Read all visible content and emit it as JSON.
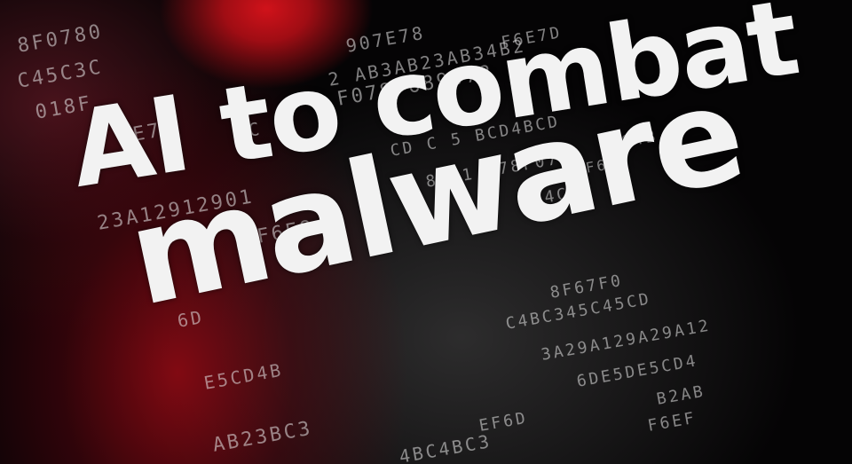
{
  "headline": {
    "line1": "AI to combat",
    "line2": "malware"
  },
  "background_code": [
    "8F0780",
    "907E78",
    "F6E7D",
    "C45C3C",
    "2 AB3AB23AB34B2",
    "018F",
    "F078F689078",
    "E7F",
    "C",
    "CD C 5 BCD4BCD",
    "C4B",
    "8901 F78F07",
    "F68",
    "23A12912901",
    "F6E8",
    "C4C5",
    "6D",
    "8F67F0",
    "C4BC345C45CD",
    "3A29A129A29A12",
    "E5CD4B",
    "6DE5DE5CD4",
    "B2AB",
    "AB23BC3",
    "EF6D",
    "4BC4BC3",
    "F6EF"
  ],
  "colors": {
    "accent_red": "#c8101a",
    "text": "#f2f2f2",
    "background": "#050405"
  }
}
